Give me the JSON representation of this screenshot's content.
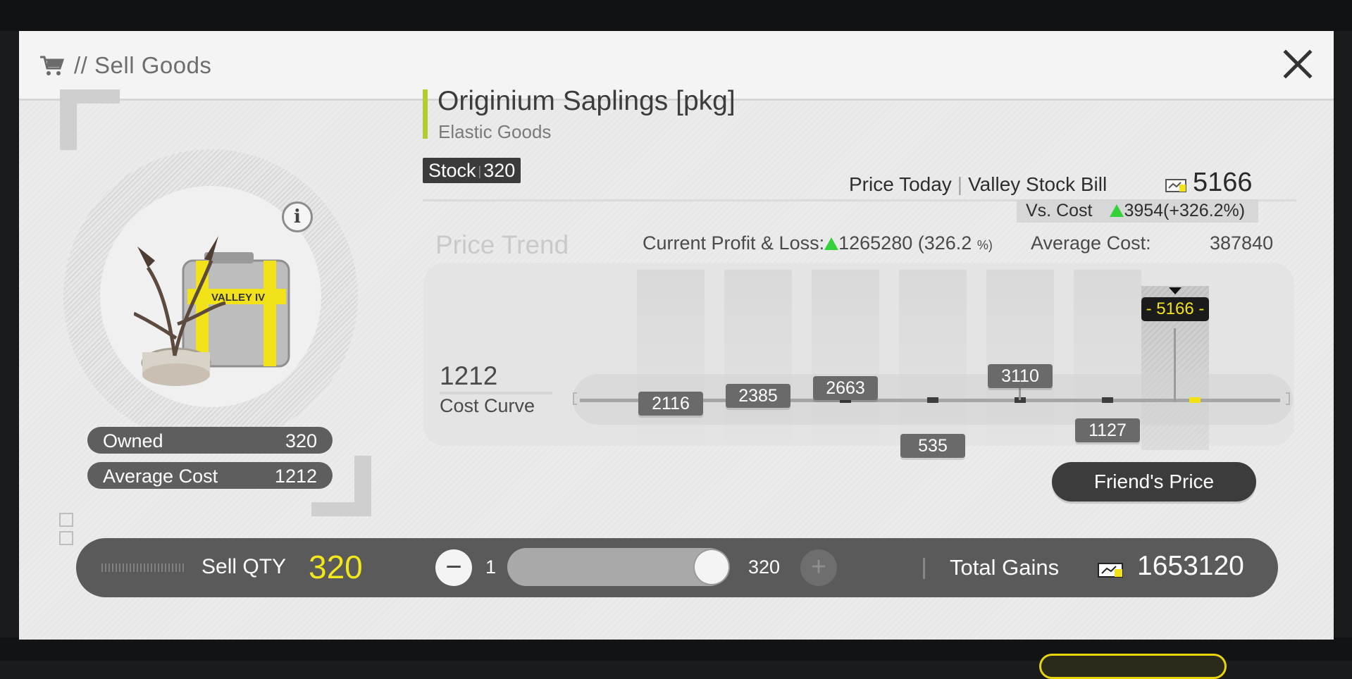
{
  "header": {
    "title": "// Sell Goods",
    "icon": "cart-icon",
    "close_icon": "close-icon"
  },
  "item": {
    "name": "Originium Saplings [pkg]",
    "category": "Elastic Goods",
    "stock_label": "Stock",
    "stock_value": "320",
    "image_text": "VALLEY IV",
    "owned_label": "Owned",
    "owned_value": "320",
    "avg_cost_label": "Average Cost",
    "avg_cost_value": "1212",
    "accent_color": "#b4cc2e"
  },
  "price": {
    "today_label": "Price Today",
    "currency_label": "Valley Stock Bill",
    "value": "5166",
    "vs_cost_label": "Vs. Cost",
    "vs_cost_value": "3954(+326.2%)"
  },
  "trend": {
    "title": "Price Trend",
    "pl_label": "Current Profit & Loss:",
    "pl_value": "1265280",
    "pl_percent": "(326.2",
    "pl_percent_unit": "%)",
    "avg_label": "Average Cost:",
    "avg_value": "387840",
    "cost_value": "1212",
    "cost_label": "Cost Curve",
    "today_tag": "- 5166 -",
    "prices": [
      "2116",
      "2385",
      "2663",
      "535",
      "3110",
      "1127"
    ],
    "positive_color": "#35d13a",
    "highlight_color": "#f2e21a"
  },
  "friends_button": "Friend's Price",
  "sell": {
    "label": "Sell QTY",
    "qty": "320",
    "min": "1",
    "max": "320",
    "minus_icon": "minus-icon",
    "plus_icon": "plus-icon",
    "gains_label": "Total Gains",
    "gains_value": "1653120"
  }
}
